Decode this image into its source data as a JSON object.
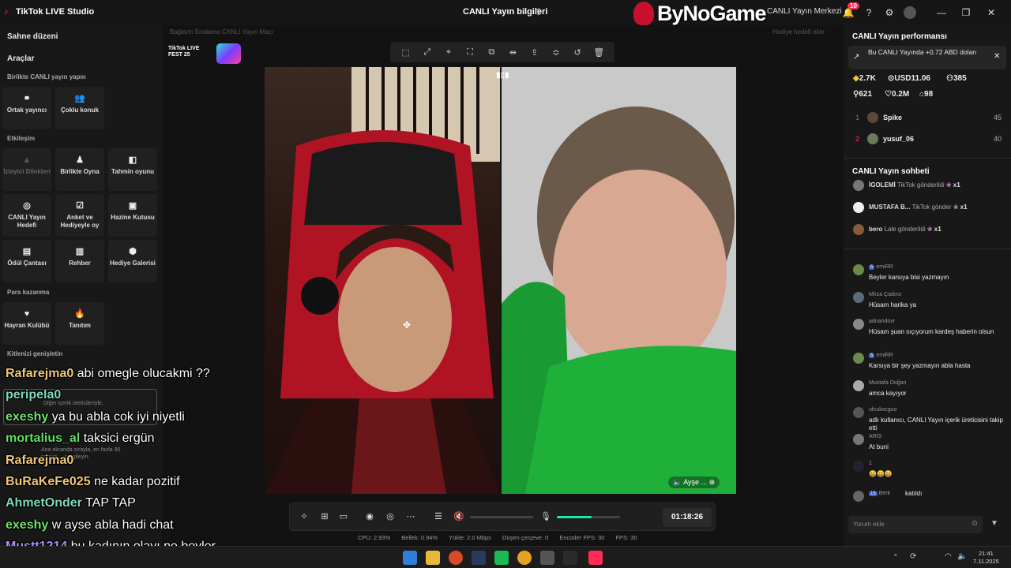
{
  "window": {
    "app_title": "TikTok LIVE Studio",
    "page_title": "CANLI Yayın bilgileri",
    "live_center": "CANLI Yayın Merkezi",
    "notification_count": "10",
    "watermark": "ByNoGame"
  },
  "sidebar": {
    "scene_layout": "Sahne düzeni",
    "tools": "Araçlar",
    "sections": {
      "collab": "Birlikte CANLI yayın yapın",
      "interaction": "Etkileşim",
      "earn": "Para kazanma",
      "expand": "Kitlenizi genişletin"
    },
    "collab_tiles": [
      "Ortak yayıncı",
      "Çoklu konuk"
    ],
    "interaction_tiles": [
      "İzleyici Dilekleri",
      "Birlikte Oyna",
      "Tahmin oyunu",
      "CANLI Yayın Hedefi",
      "Anket ve Hediyeyle oy",
      "Hazine Kutusu",
      "Ödül Çantası",
      "Rehber",
      "Hediye Galerisi"
    ],
    "earn_tiles": [
      "Hayran Kulübü",
      "Tanıtım"
    ]
  },
  "stage": {
    "faded_left": "Bağlantı Sıralama    CANLI Yayın Maçı",
    "faded_right": "Hediye hedefi ekle",
    "fest_logo": "TikTok LIVE FEST 25",
    "video_label": "Ayşe ...",
    "timer": "01:18:26",
    "mic_level": 0.55,
    "stats": [
      "CPU: 2.93%",
      "Bellek: 0.94%",
      "Yükle: 2.0 Mbps",
      "Düşen çerçeve: 0",
      "Encoder FPS: 30",
      "FPS: 30"
    ]
  },
  "overlay_chat": [
    {
      "name": "Rafarejma0",
      "msg": "abi omegle olucakmi ??",
      "color": "#f0c878"
    },
    {
      "name": "peripela0",
      "msg": "",
      "color": "#7fd8c0"
    },
    {
      "name": "exeshy",
      "msg": "ya bu abla cok iyi niyetli",
      "color": "#6ee06a"
    },
    {
      "name": "mortalius_al",
      "msg": "taksici ergün",
      "color": "#5fe060"
    },
    {
      "name": "Rafarejma0",
      "msg": "",
      "color": "#f0c878"
    },
    {
      "name": "BuRaKeFe025",
      "msg": "ne kadar pozitif",
      "color": "#f0c878"
    },
    {
      "name": "AhmetOnder",
      "msg": "TAP TAP",
      "color": "#7fd8c0"
    },
    {
      "name": "exeshy",
      "msg": "w ayse abla hadi chat",
      "color": "#6ee06a"
    },
    {
      "name": "Mustt1214",
      "msg": "bu kadının olayı ne beyler",
      "color": "#b48cff"
    }
  ],
  "overlay_popup": {
    "line1": "Diğer içerik üreticileriyle,",
    "line2": "Ana ekranda sırayla, en fazla 90",
    "line3": "saniye ... sergileyin."
  },
  "right_panel": {
    "perf_title": "CANLI Yayın performansı",
    "perf_banner": "Bu CANLI Yayında +0.72 ABD doları",
    "stats": [
      "2.7K",
      "USD11.06",
      "385",
      "621",
      "0.2M",
      "98"
    ],
    "ranking": [
      {
        "rank": "1",
        "name": "Spike",
        "score": "45"
      },
      {
        "rank": "2",
        "name": "yusuf_06",
        "score": "40"
      }
    ],
    "chat_title": "CANLI Yayın sohbeti",
    "gifts": [
      {
        "name": "İGOLEMİ",
        "text": "TikTok gönderildi",
        "count": "x1"
      },
      {
        "name": "MUSTAFA B...",
        "text": "TikTok gönder",
        "count": "x1"
      },
      {
        "name": "bero",
        "text": "Lale gönderildi",
        "count": "x1"
      }
    ],
    "messages": [
      {
        "name": "emiRR",
        "level": "5",
        "msg": "Beyler karsıya bisi yazmayın"
      },
      {
        "name": "Mirza Çadırcı",
        "level": "",
        "msg": "Hüsam harika ya"
      },
      {
        "name": "adnandovr",
        "level": "",
        "msg": "Hüsam şuan sıçıyorum kardeş haberin olsun"
      },
      {
        "name": "emiRR",
        "level": "5",
        "msg": "Karsıya bir şey yazmayın abla hasta"
      },
      {
        "name": "Mustafa Doğan",
        "level": "",
        "msg": "amca kayıyor"
      },
      {
        "name": "ufcukxcguo",
        "level": "",
        "msg": "adlı kullanıcı, CANLI Yayın içerik üreticisini takip etti"
      },
      {
        "name": "ARİS",
        "level": "",
        "msg": "At buni"
      },
      {
        "name": "1",
        "level": "",
        "msg": "😄😄😄"
      },
      {
        "name": "Berk",
        "level": "15",
        "msg": "katıldı"
      }
    ],
    "comment_placeholder": "Yorum ekle"
  },
  "taskbar": {
    "time": "21:41",
    "date": "7.11.2025"
  },
  "colors": {
    "accent_pink": "#ff2d55",
    "mic_green": "#1de9a0",
    "level_blue": "#3b5bd6"
  }
}
